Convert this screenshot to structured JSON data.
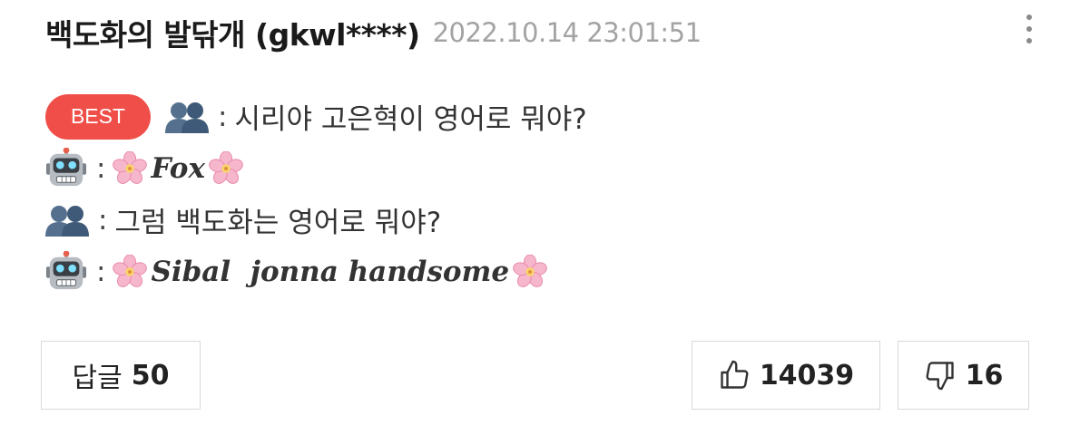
{
  "comment": {
    "author": "백도화의 발닦개 (gkwl****)",
    "timestamp": "2022.10.14 23:01:51",
    "badge": "BEST",
    "separator": ":",
    "lines": [
      {
        "speaker_icon": "busts-icon",
        "text": "시리야 고은혁이 영어로 뭐야?"
      },
      {
        "speaker_icon": "robot-icon",
        "text": "Fox"
      },
      {
        "speaker_icon": "busts-icon",
        "text": "그럼 백도화는 영어로 뭐야?"
      },
      {
        "speaker_icon": "robot-icon",
        "text": "Sibal  jonna handsome"
      }
    ],
    "decoration_icon": "cherry-blossom-icon"
  },
  "actions": {
    "reply_label": "답글",
    "reply_count": "50",
    "like_count": "14039",
    "dislike_count": "16"
  },
  "colors": {
    "badge": "#f04e48",
    "timestamp": "#a3a3a3",
    "border": "#d9d9d9"
  }
}
